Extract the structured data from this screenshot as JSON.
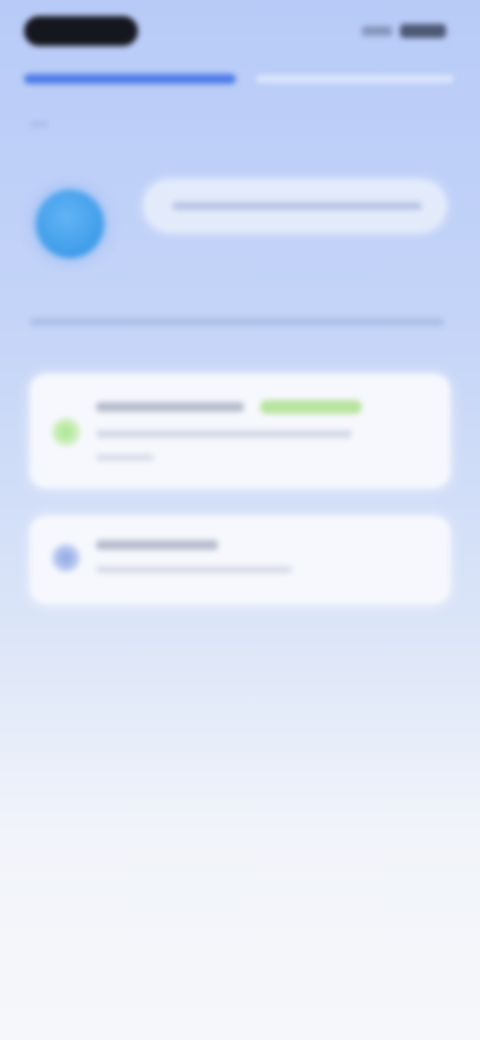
{
  "screen": {
    "description_visible_text": "",
    "state": "content fully blurred — no legible text"
  },
  "status_bar": {
    "time": "",
    "icons": [
      "signal-icon",
      "battery-icon"
    ]
  },
  "tabs": [
    {
      "label": "",
      "active": true
    },
    {
      "label": "",
      "active": false
    }
  ],
  "profile": {
    "name": "",
    "avatar_color": "#4aa3ef"
  },
  "section": {
    "title": ""
  },
  "cards": [
    {
      "title": "",
      "tag": "",
      "subtitle": "",
      "detail": "",
      "icon": "green-status-icon",
      "accent": "#9fdc86"
    },
    {
      "title": "",
      "subtitle": "",
      "icon": "blue-status-icon",
      "accent": "#8aa4e4"
    }
  ],
  "colors": {
    "background_top": "#b8cbf8",
    "background_bottom": "#f6f7fa",
    "accent": "#4d7be8"
  }
}
